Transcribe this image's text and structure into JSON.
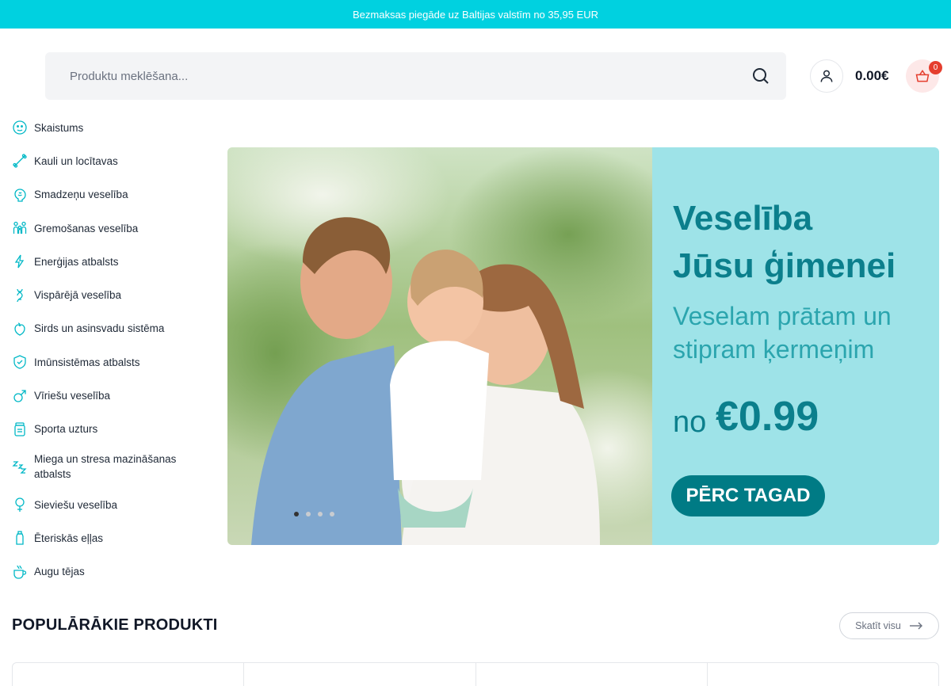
{
  "topbar": {
    "text": "Bezmaksas piegāde uz Baltijas valstīm no 35,95 EUR"
  },
  "search": {
    "placeholder": "Produktu meklēšana..."
  },
  "header": {
    "cart_total": "0.00€",
    "cart_count": "0"
  },
  "categories": [
    {
      "label": "Skaistums",
      "icon": "face-icon"
    },
    {
      "label": "Kauli un locītavas",
      "icon": "bone-icon"
    },
    {
      "label": "Smadzeņu veselība",
      "icon": "brain-icon"
    },
    {
      "label": "Gremošanas veselība",
      "icon": "family-icon"
    },
    {
      "label": "Enerģijas atbalsts",
      "icon": "lightning-icon"
    },
    {
      "label": "Vispārējā veselība",
      "icon": "dna-icon"
    },
    {
      "label": "Sirds un asinsvadu sistēma",
      "icon": "heart-icon"
    },
    {
      "label": "Imūnsistēmas atbalsts",
      "icon": "shield-icon"
    },
    {
      "label": "Vīriešu veselība",
      "icon": "male-icon"
    },
    {
      "label": "Sporta uzturs",
      "icon": "jar-icon"
    },
    {
      "label": "Miega un stresa mazināšanas atbalsts",
      "icon": "sleep-icon"
    },
    {
      "label": "Sieviešu veselība",
      "icon": "female-icon"
    },
    {
      "label": "Ēteriskās eļļas",
      "icon": "bottle-icon"
    },
    {
      "label": "Augu tējas",
      "icon": "tea-icon"
    }
  ],
  "hero": {
    "title_line1": "Veselība",
    "title_line2": "Jūsu ģimenei",
    "subtitle_line1": "Veselam prātam un",
    "subtitle_line2": "stipram ķermeņim",
    "price_prefix": "no",
    "price": "€0.99",
    "cta": "PĒRC TAGAD",
    "slides": 4,
    "active_slide": 1
  },
  "popular": {
    "title": "POPULĀRĀKIE PRODUKTI",
    "view_all": "Skatīt visu"
  },
  "colors": {
    "accent": "#00d1e0",
    "teal_dark": "#007b85",
    "hero_panel": "#9ee3e8"
  }
}
